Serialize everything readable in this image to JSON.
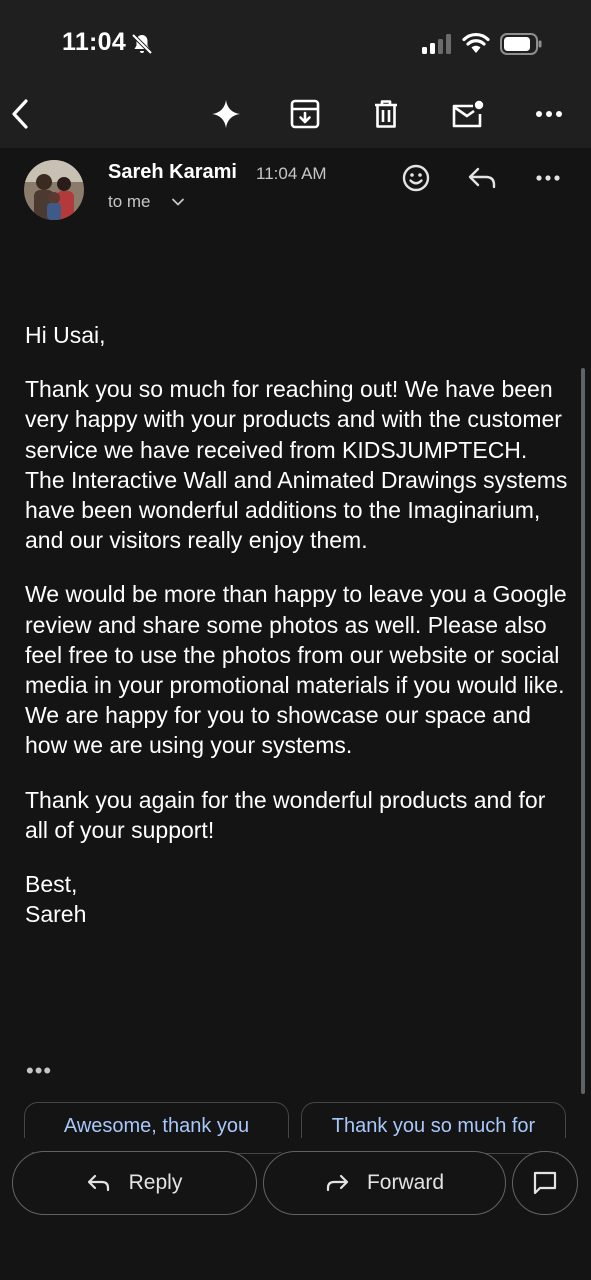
{
  "status_bar": {
    "time": "11:04"
  },
  "email": {
    "sender_name": "Sareh Karami",
    "time": "11:04 AM",
    "recipient": "to me",
    "greeting": "Hi Usai,",
    "paragraphs": [
      "Thank you so much for reaching out! We have been very happy with your products and with the customer service we have received from KIDSJUMPTECH. The Interactive Wall and Animated Drawings systems have been wonderful additions to the Imaginarium, and our visitors really enjoy them.",
      "We would be more than happy to leave you a Google review and share some photos as well. Please also feel free to use the photos from our website or social media in your promotional materials if you would like. We are happy for you to showcase our space and how we are using your systems.",
      "Thank you again for the wonderful products and for all of your support!"
    ],
    "signoff_line1": "Best,",
    "signoff_line2": "Sareh",
    "trimmed_content": "•••"
  },
  "smart_replies": [
    "Awesome, thank you",
    "Thank you so much for"
  ],
  "actions": {
    "reply_label": "Reply",
    "forward_label": "Forward"
  },
  "icons": {
    "back": "back-arrow-icon",
    "gemini": "sparkle-icon",
    "archive": "archive-icon",
    "delete": "trash-icon",
    "unread": "mark-unread-icon",
    "more": "more-icon",
    "emoji": "emoji-react-icon",
    "reply": "reply-icon",
    "forward": "forward-icon",
    "compose": "chat-icon"
  },
  "colors": {
    "background": "#141414",
    "bar": "#1f1f1f",
    "accent": "#a8c7fa",
    "muted": "#c4c7c5"
  }
}
